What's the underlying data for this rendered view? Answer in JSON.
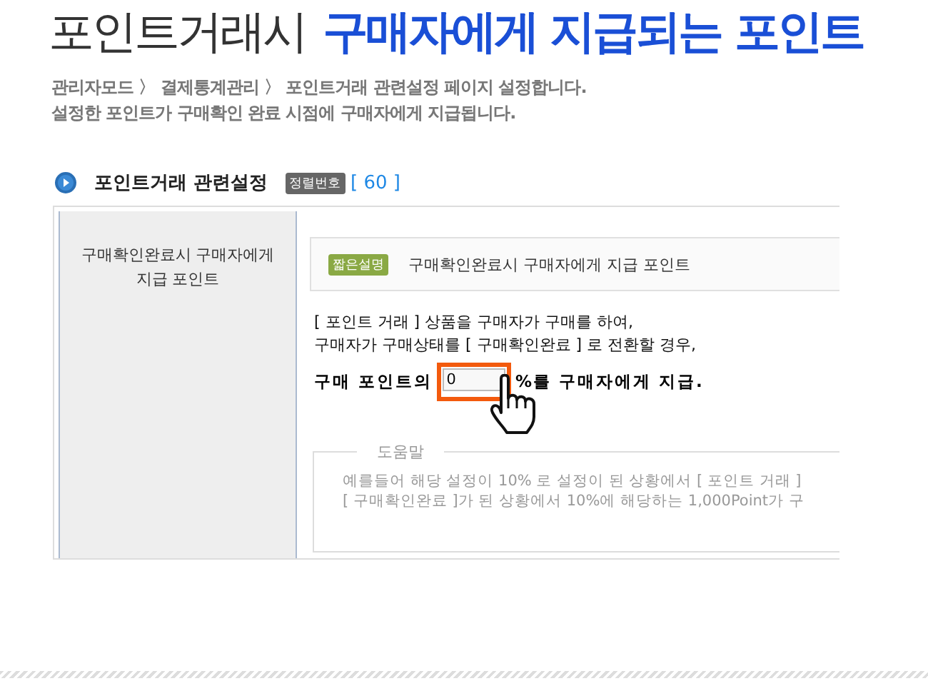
{
  "title": {
    "light": "포인트거래시",
    "bold": "구매자에게 지급되는 포인트"
  },
  "description": [
    "관리자모드 〉 결제통계관리 〉 포인트거래 관련설정 페이지 설정합니다.",
    "설정한 포인트가 구매확인 완료 시점에 구매자에게 지급됩니다."
  ],
  "section": {
    "title": "포인트거래 관련설정",
    "badge": "정렬번호",
    "number": "[ 60 ]"
  },
  "setting": {
    "label": "구매확인완료시 구매자에게 지급 포인트",
    "summary_badge": "짧은설명",
    "summary": "구매확인완료시 구매자에게 지급 포인트",
    "lines": [
      "[ 포인트 거래 ] 상품을 구매자가 구매를 하여,",
      "구매자가 구매상태를 [ 구매확인완료 ] 로 전환할 경우,"
    ],
    "prefix": "구매 포인트의",
    "value": "0",
    "suffix": "%를 구매자에게 지급.",
    "help_title": "도움말",
    "help_lines": [
      "예를들어 해당 설정이 10% 로 설정이 된 상황에서 [ 포인트 거래 ]",
      "[ 구매확인완료 ]가 된 상황에서 10%에 해당하는 1,000Point가 구"
    ]
  }
}
